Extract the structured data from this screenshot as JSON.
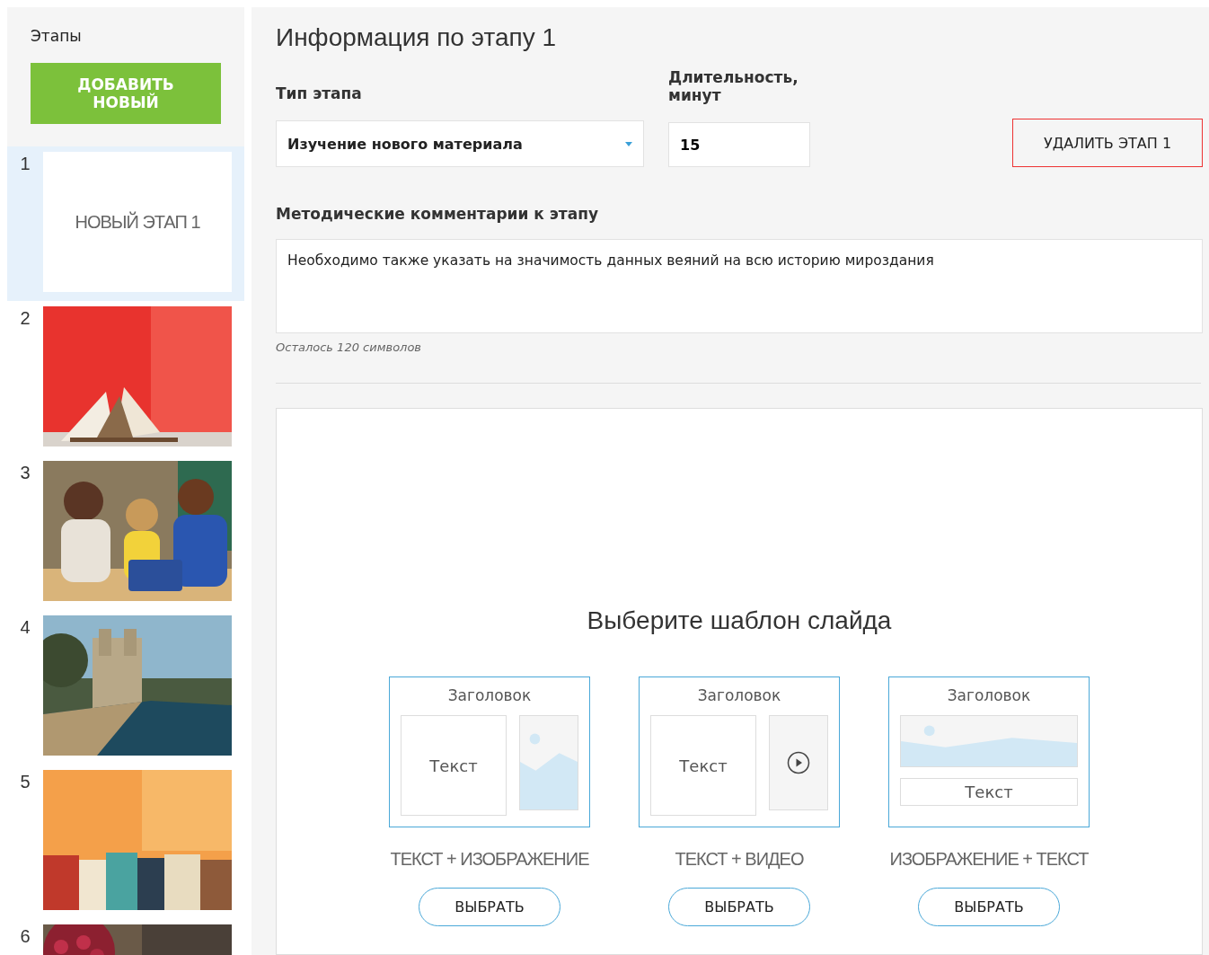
{
  "sidebar": {
    "title": "Этапы",
    "add_button": "ДОБАВИТЬ НОВЫЙ",
    "stages": [
      {
        "number": "1",
        "kind": "text",
        "label": "НОВЫЙ ЭТАП 1",
        "selected": true
      },
      {
        "number": "2",
        "kind": "picture",
        "selected": false
      },
      {
        "number": "3",
        "kind": "picture",
        "selected": false
      },
      {
        "number": "4",
        "kind": "picture",
        "selected": false
      },
      {
        "number": "5",
        "kind": "picture",
        "selected": false
      },
      {
        "number": "6",
        "kind": "picture",
        "selected": false
      }
    ]
  },
  "main": {
    "title": "Информация по этапу 1",
    "type_label": "Тип этапа",
    "type_value": "Изучение нового материала",
    "duration_label": "Длительность, минут",
    "duration_value": "15",
    "delete_button": "УДАЛИТЬ ЭТАП 1",
    "comments_label": "Методические комментарии к этапу",
    "comments_value": "Необходимо также указать на значимость данных веяний на всю историю мироздания",
    "counter": "Осталось 120 символов",
    "template_heading": "Выберите шаблон слайда",
    "templates": [
      {
        "kind": "text-image",
        "heading": "Заголовок",
        "body": "Текст",
        "caption": "ТЕКСТ + ИЗОБРАЖЕНИЕ",
        "button": "ВЫБРАТЬ"
      },
      {
        "kind": "text-video",
        "heading": "Заголовок",
        "body": "Текст",
        "caption": "ТЕКСТ + ВИДЕО",
        "button": "ВЫБРАТЬ"
      },
      {
        "kind": "image-text",
        "heading": "Заголовок",
        "body": "Текст",
        "caption": "ИЗОБРАЖЕНИЕ + ТЕКСТ",
        "button": "ВЫБРАТЬ"
      }
    ]
  }
}
